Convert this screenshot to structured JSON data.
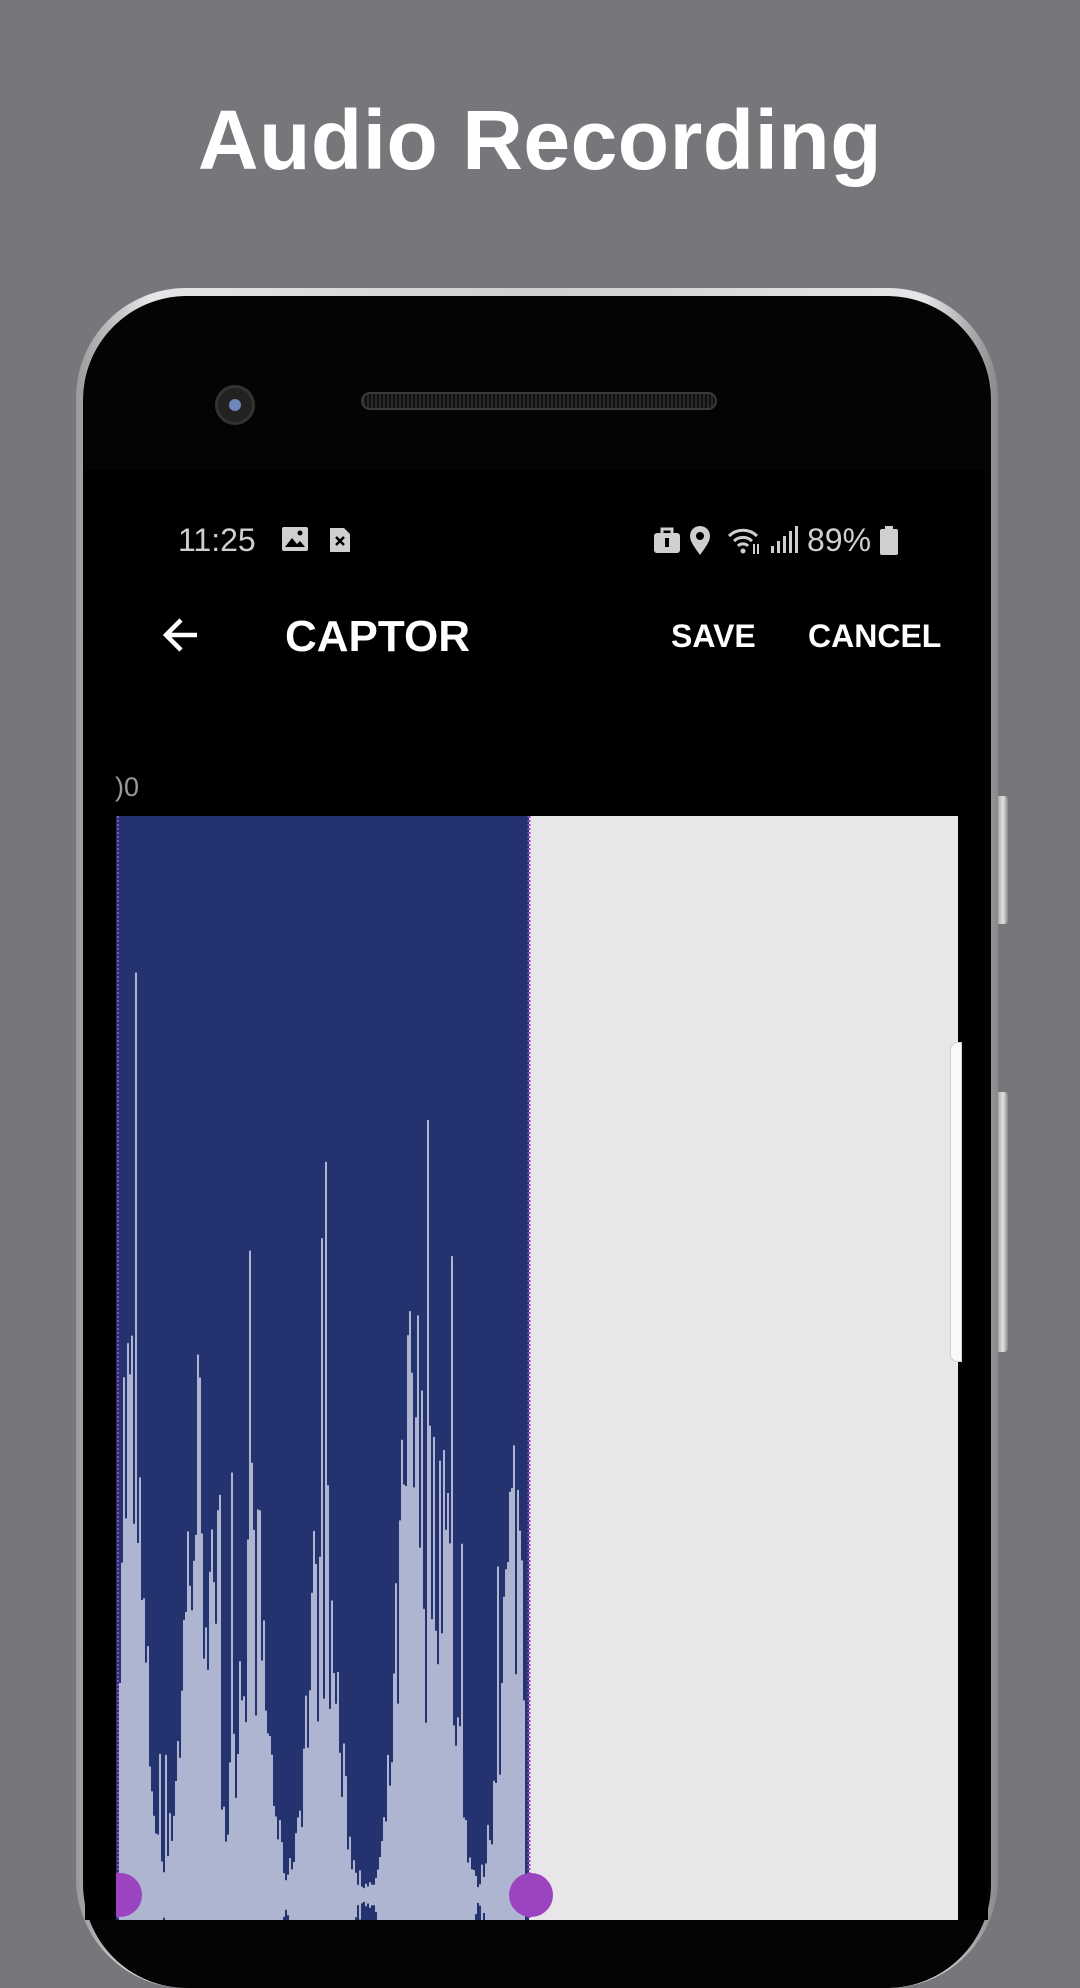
{
  "headline": "Audio Recording",
  "status_bar": {
    "time": "11:25",
    "left_icons": [
      "image-icon",
      "sim-error-icon"
    ],
    "right_icons": [
      "lock-bag-icon",
      "location-icon",
      "wifi-icon",
      "signal-icon",
      "battery-icon"
    ],
    "battery": "89%"
  },
  "toolbar": {
    "title": "CAPTOR",
    "save_label": "SAVE",
    "cancel_label": "CANCEL"
  },
  "timeline": {
    "label": ")0"
  },
  "waveform": {
    "selection_color": "#24326f",
    "wave_color": "#aeb5d0",
    "background_color": "#e8e6e8",
    "handle_color": "#9b44c0",
    "recorded_fraction": 0.49
  }
}
